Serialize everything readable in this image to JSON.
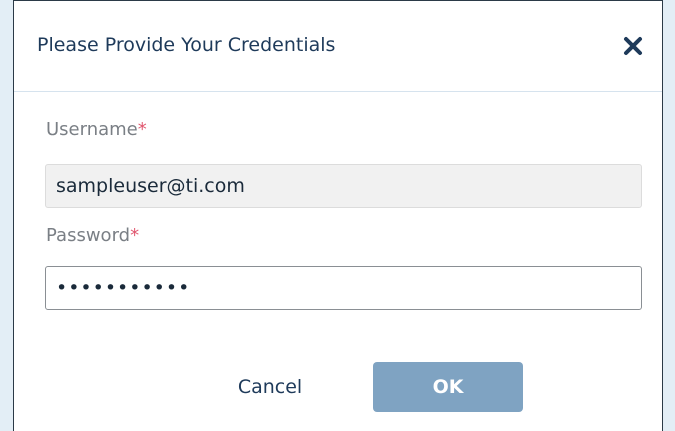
{
  "dialog": {
    "title": "Please Provide Your Credentials",
    "close_icon": "close-icon",
    "username": {
      "label": "Username",
      "required_mark": "*",
      "value": "sampleuser@ti.com"
    },
    "password": {
      "label": "Password",
      "required_mark": "*",
      "value": "•••••••••••"
    },
    "buttons": {
      "cancel_label": "Cancel",
      "ok_label": "OK"
    }
  },
  "colors": {
    "title_text": "#1e3a5a",
    "required_mark": "#e0566e",
    "ok_button": "#7fa3c2",
    "background": "#e3eef6"
  }
}
